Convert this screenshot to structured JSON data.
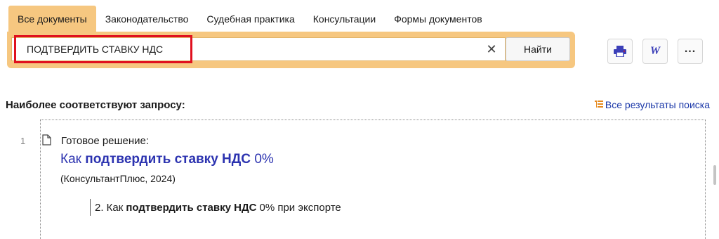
{
  "tabs": [
    {
      "label": "Все документы",
      "active": true
    },
    {
      "label": "Законодательство",
      "active": false
    },
    {
      "label": "Судебная практика",
      "active": false
    },
    {
      "label": "Консультации",
      "active": false
    },
    {
      "label": "Формы документов",
      "active": false
    }
  ],
  "search": {
    "value": "ПОДТВЕРДИТЬ СТАВКУ НДС",
    "clear_icon": "close-icon",
    "find_label": "Найти"
  },
  "toolbar": {
    "print_icon": "print-icon",
    "word_icon": "word-icon",
    "word_glyph": "W",
    "more_icon": "more-icon",
    "more_glyph": "..."
  },
  "results": {
    "heading": "Наиболее соответствуют запросу:",
    "all_results_label": "Все результаты поиска",
    "items": [
      {
        "number": "1",
        "type": "Готовое решение:",
        "title_prefix": "Как",
        "title_bold": "подтвердить ставку НДС",
        "title_suffix": "0%",
        "source": "(КонсультантПлюс, 2024)",
        "sub_prefix": "2. Как",
        "sub_bold": "подтвердить ставку НДС",
        "sub_suffix": "0% при экспорте"
      }
    ]
  },
  "colors": {
    "accent": "#f6c780",
    "highlight_border": "#e0101e",
    "link": "#2c33b0"
  }
}
